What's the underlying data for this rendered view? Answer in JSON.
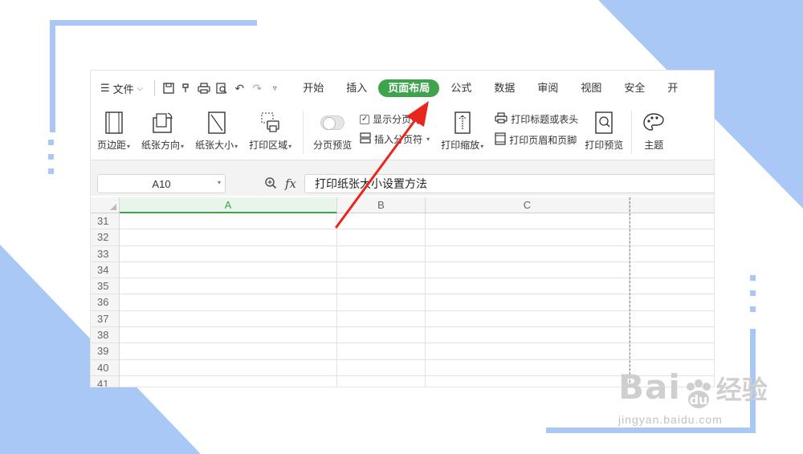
{
  "colors": {
    "accent_green": "#3fa34d",
    "decor_blue": "#a9c8f5",
    "arrow_red": "#e8261d"
  },
  "menubar": {
    "menu_icon": "hamburger-icon",
    "file_label": "文件",
    "quick_icons": [
      "save-icon",
      "format-painter-icon",
      "print-icon",
      "print-preview-icon",
      "undo-icon",
      "redo-icon",
      "customize-icon"
    ],
    "tabs": [
      {
        "label": "开始",
        "active": false
      },
      {
        "label": "插入",
        "active": false
      },
      {
        "label": "页面布局",
        "active": true
      },
      {
        "label": "公式",
        "active": false
      },
      {
        "label": "数据",
        "active": false
      },
      {
        "label": "审阅",
        "active": false
      },
      {
        "label": "视图",
        "active": false
      },
      {
        "label": "安全",
        "active": false
      },
      {
        "label": "开",
        "active": false
      }
    ]
  },
  "ribbon": {
    "margins": "页边距",
    "orientation": "纸张方向",
    "size": "纸张大小",
    "print_area": "打印区域",
    "page_break_preview": "分页预览",
    "show_page_breaks": "显示分页符",
    "insert_page_break": "插入分页符",
    "print_scale": "打印缩放",
    "print_titles": "打印标题或表头",
    "print_header_footer": "打印页眉和页脚",
    "print_preview": "打印预览",
    "theme": "主题"
  },
  "formula_bar": {
    "name_box": "A10",
    "fx": "fx",
    "formula": "打印纸张大小设置方法"
  },
  "sheet": {
    "columns": [
      "A",
      "B",
      "C"
    ],
    "selected_column": "A",
    "rows": [
      "31",
      "32",
      "33",
      "34",
      "35",
      "36",
      "37",
      "38",
      "39",
      "40",
      "41"
    ]
  },
  "watermark": {
    "logo": "Bai",
    "logo_tail": "du",
    "cn": "经验",
    "url": "jingyan.baidu.com"
  }
}
